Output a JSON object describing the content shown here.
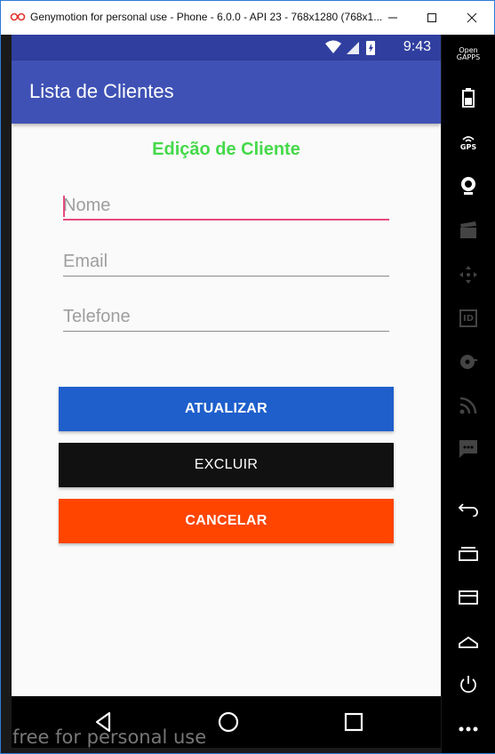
{
  "window": {
    "title": "Genymotion for personal use - Phone - 6.0.0 - API 23 - 768x1280 (768x1..."
  },
  "statusbar": {
    "time": "9:43"
  },
  "appbar": {
    "title": "Lista de Clientes"
  },
  "form": {
    "heading": "Edição de Cliente",
    "fields": {
      "nome": {
        "placeholder": "Nome",
        "value": ""
      },
      "email": {
        "placeholder": "Email",
        "value": ""
      },
      "telefone": {
        "placeholder": "Telefone",
        "value": ""
      }
    },
    "buttons": {
      "atualizar": "ATUALIZAR",
      "excluir": "EXCLUIR",
      "cancelar": "CANCELAR"
    }
  },
  "sidepanel": {
    "gapps_label_line1": "Open",
    "gapps_label_line2": "GAPPS",
    "gps_label": "GPS",
    "id_label": "ID"
  },
  "watermark": "free for personal use",
  "colors": {
    "primary": "#3f51b5",
    "primary_dark": "#303f9f",
    "heading_green": "#45d94a",
    "accent_pink": "#e84a7b",
    "btn_atualizar": "#1f5fcc",
    "btn_excluir": "#111111",
    "btn_cancelar": "#ff4500"
  }
}
